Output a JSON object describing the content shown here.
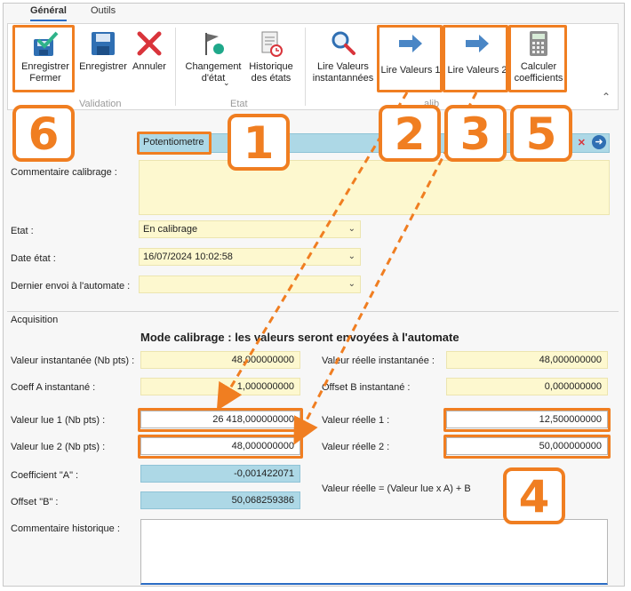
{
  "tabs": [
    {
      "label": "Général"
    },
    {
      "label": "Outils"
    }
  ],
  "ribbon": {
    "buttons": {
      "save_close": "Enregistrer Fermer",
      "save": "Enregistrer",
      "cancel": "Annuler",
      "change_state": "Changement d'état",
      "state_history": "Historique des états",
      "read_instant": "Lire Valeurs instantannées",
      "read_values_1": "Lire Valeurs 1",
      "read_values_2": "Lire Valeurs 2",
      "compute_coeffs": "Calculer coefficients"
    },
    "groups": {
      "validation": "Validation",
      "etat": "Etat",
      "calibration_partial": "alib"
    }
  },
  "form": {
    "name_value": "Potentiometre",
    "comment_label": "Commentaire calibrage :",
    "etat_label": "Etat :",
    "etat_value": "En calibrage",
    "date_label": "Date état :",
    "date_value": "16/07/2024 10:02:58",
    "last_send_label": "Dernier envoi à l'automate :",
    "last_send_value": ""
  },
  "acquisition": {
    "section_title": "Acquisition",
    "mode_title": "Mode calibrage : les valeurs seront envoyées à l'automate",
    "valeur_instantanee_label": "Valeur instantanée (Nb pts) :",
    "valeur_instantanee": "48,000000000",
    "valeur_reelle_instantanee_label": "Valeur réelle instantanée :",
    "valeur_reelle_instantanee": "48,000000000",
    "coeff_a_inst_label": "Coeff A instantané :",
    "coeff_a_inst": "1,000000000",
    "offset_b_inst_label": "Offset B instantané :",
    "offset_b_inst": "0,000000000",
    "valeur_lue_1_label": "Valeur lue 1 (Nb pts) :",
    "valeur_lue_1": "26 418,000000000",
    "valeur_reelle_1_label": "Valeur réelle 1 :",
    "valeur_reelle_1": "12,500000000",
    "valeur_lue_2_label": "Valeur lue 2 (Nb pts) :",
    "valeur_lue_2": "48,000000000",
    "valeur_reelle_2_label": "Valeur réelle 2 :",
    "valeur_reelle_2": "50,000000000",
    "coefficient_a_label": "Coefficient \"A\" :",
    "coefficient_a": "-0,001422071",
    "offset_b_label": "Offset \"B\" :",
    "offset_b": "50,068259386",
    "formula": "Valeur réelle = (Valeur lue x A) + B",
    "historic_comment_label": "Commentaire historique :"
  },
  "annotations": [
    "1",
    "2",
    "3",
    "4",
    "5",
    "6"
  ],
  "colors": {
    "highlight": "#f07e21",
    "yellow_field": "#fdf8cf",
    "blue_field": "#add8e6",
    "accent": "#2b6cc4"
  }
}
